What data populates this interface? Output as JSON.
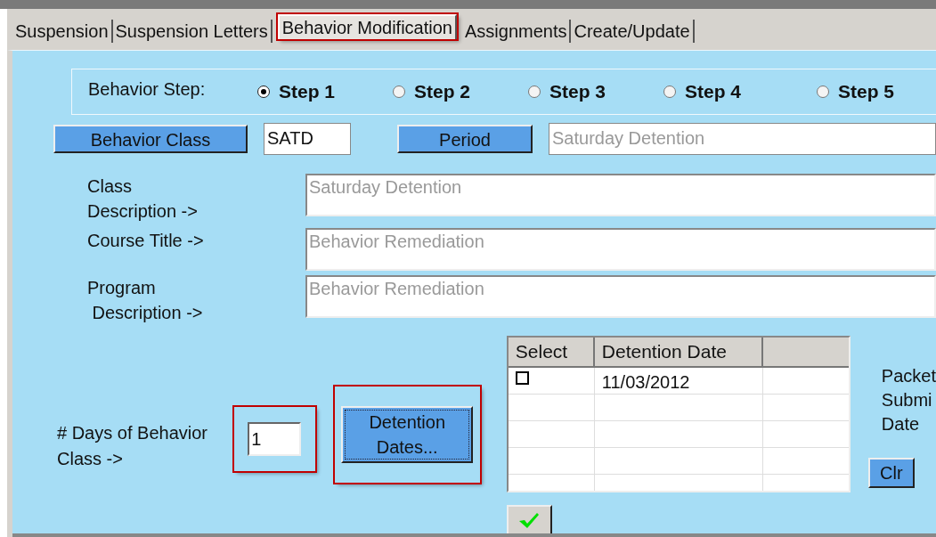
{
  "tabs": [
    {
      "label": "Suspension",
      "selected": false,
      "highlighted": false
    },
    {
      "label": "Suspension Letters",
      "selected": false,
      "highlighted": false
    },
    {
      "label": "Behavior Modification",
      "selected": true,
      "highlighted": true
    },
    {
      "label": "Assignments",
      "selected": false,
      "highlighted": false
    },
    {
      "label": "Create/Update",
      "selected": false,
      "highlighted": false
    }
  ],
  "behavior_step": {
    "label": "Behavior Step:",
    "steps": [
      {
        "label": "Step 1",
        "selected": true
      },
      {
        "label": "Step 2",
        "selected": false
      },
      {
        "label": "Step 3",
        "selected": false
      },
      {
        "label": "Step 4",
        "selected": false
      },
      {
        "label": "Step 5",
        "selected": false
      }
    ]
  },
  "class_row": {
    "class_button": "Behavior Class",
    "class_code": "SATD",
    "period_button": "Period",
    "period_value": "Saturday Detention"
  },
  "descriptions": [
    {
      "label": "Class\nDescription ->",
      "value": "Saturday Detention"
    },
    {
      "label": "Course Title ->",
      "value": "Behavior Remediation"
    },
    {
      "label": "Program\n Description ->",
      "value": "Behavior Remediation"
    }
  ],
  "days": {
    "label": "# Days of Behavior\nClass ->",
    "value": "1",
    "highlighted": true
  },
  "dates_button": {
    "label": "Detention\nDates...",
    "highlighted": true
  },
  "table": {
    "columns": [
      "Select",
      "Detention Date"
    ],
    "rows": [
      {
        "checked": false,
        "date": "11/03/2012"
      }
    ]
  },
  "packet_label": "Packet\nSubmi\nDate",
  "clear_button": "Clr"
}
